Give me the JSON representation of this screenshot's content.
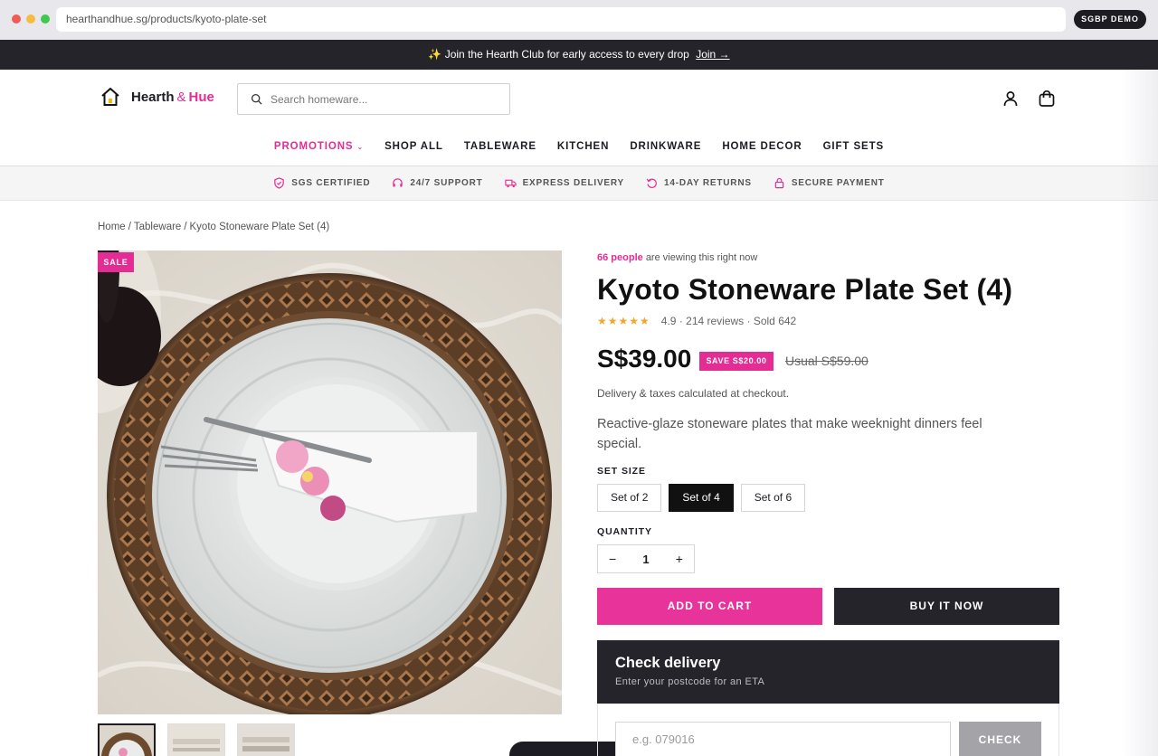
{
  "browser": {
    "url": "hearthandhue.sg/products/kyoto-plate-set",
    "badge": "SGBP DEMO"
  },
  "announcement": {
    "sparkle": "✨",
    "text": "Join the Hearth Club for early access to every drop",
    "link": "Join →"
  },
  "header": {
    "brand_part1": "Hearth",
    "brand_amp": "&",
    "brand_part2": "Hue",
    "search_placeholder": "Search homeware..."
  },
  "nav": {
    "promotions": "PROMOTIONS",
    "items": [
      "SHOP ALL",
      "TABLEWARE",
      "KITCHEN",
      "DRINKWARE",
      "HOME DECOR",
      "GIFT SETS"
    ]
  },
  "trust": [
    "SGS CERTIFIED",
    "24/7 SUPPORT",
    "EXPRESS DELIVERY",
    "14-DAY RETURNS",
    "SECURE PAYMENT"
  ],
  "breadcrumb": [
    "Home",
    "Tableware",
    "Kyoto Stoneware Plate Set (4)"
  ],
  "product": {
    "sale_badge": "SALE",
    "viewing_count": "66 people",
    "viewing_text": "are viewing this right now",
    "title": "Kyoto Stoneware Plate Set (4)",
    "stars": "★★★★★",
    "rating_text": "4.9 · 214 reviews · Sold 642",
    "price": "S$39.00",
    "save_badge": "SAVE S$20.00",
    "usual_price": "Usual S$59.00",
    "delivery_note": "Delivery & taxes calculated at checkout.",
    "description": "Reactive-glaze stoneware plates that make weeknight dinners feel special.",
    "size_label": "SET SIZE",
    "sizes": [
      "Set of 2",
      "Set of 4",
      "Set of 6"
    ],
    "selected_size": "Set of 4",
    "quantity_label": "QUANTITY",
    "quantity": "1",
    "minus": "−",
    "plus": "+",
    "add_to_cart": "ADD TO CART",
    "buy_now": "BUY IT NOW"
  },
  "check_delivery": {
    "title": "Check delivery",
    "subtitle": "Enter your postcode for an ETA",
    "placeholder": "e.g. 079016",
    "button": "CHECK"
  },
  "colors": {
    "accent": "#e32d94",
    "dark": "#25242b",
    "star": "#f0a72c"
  }
}
